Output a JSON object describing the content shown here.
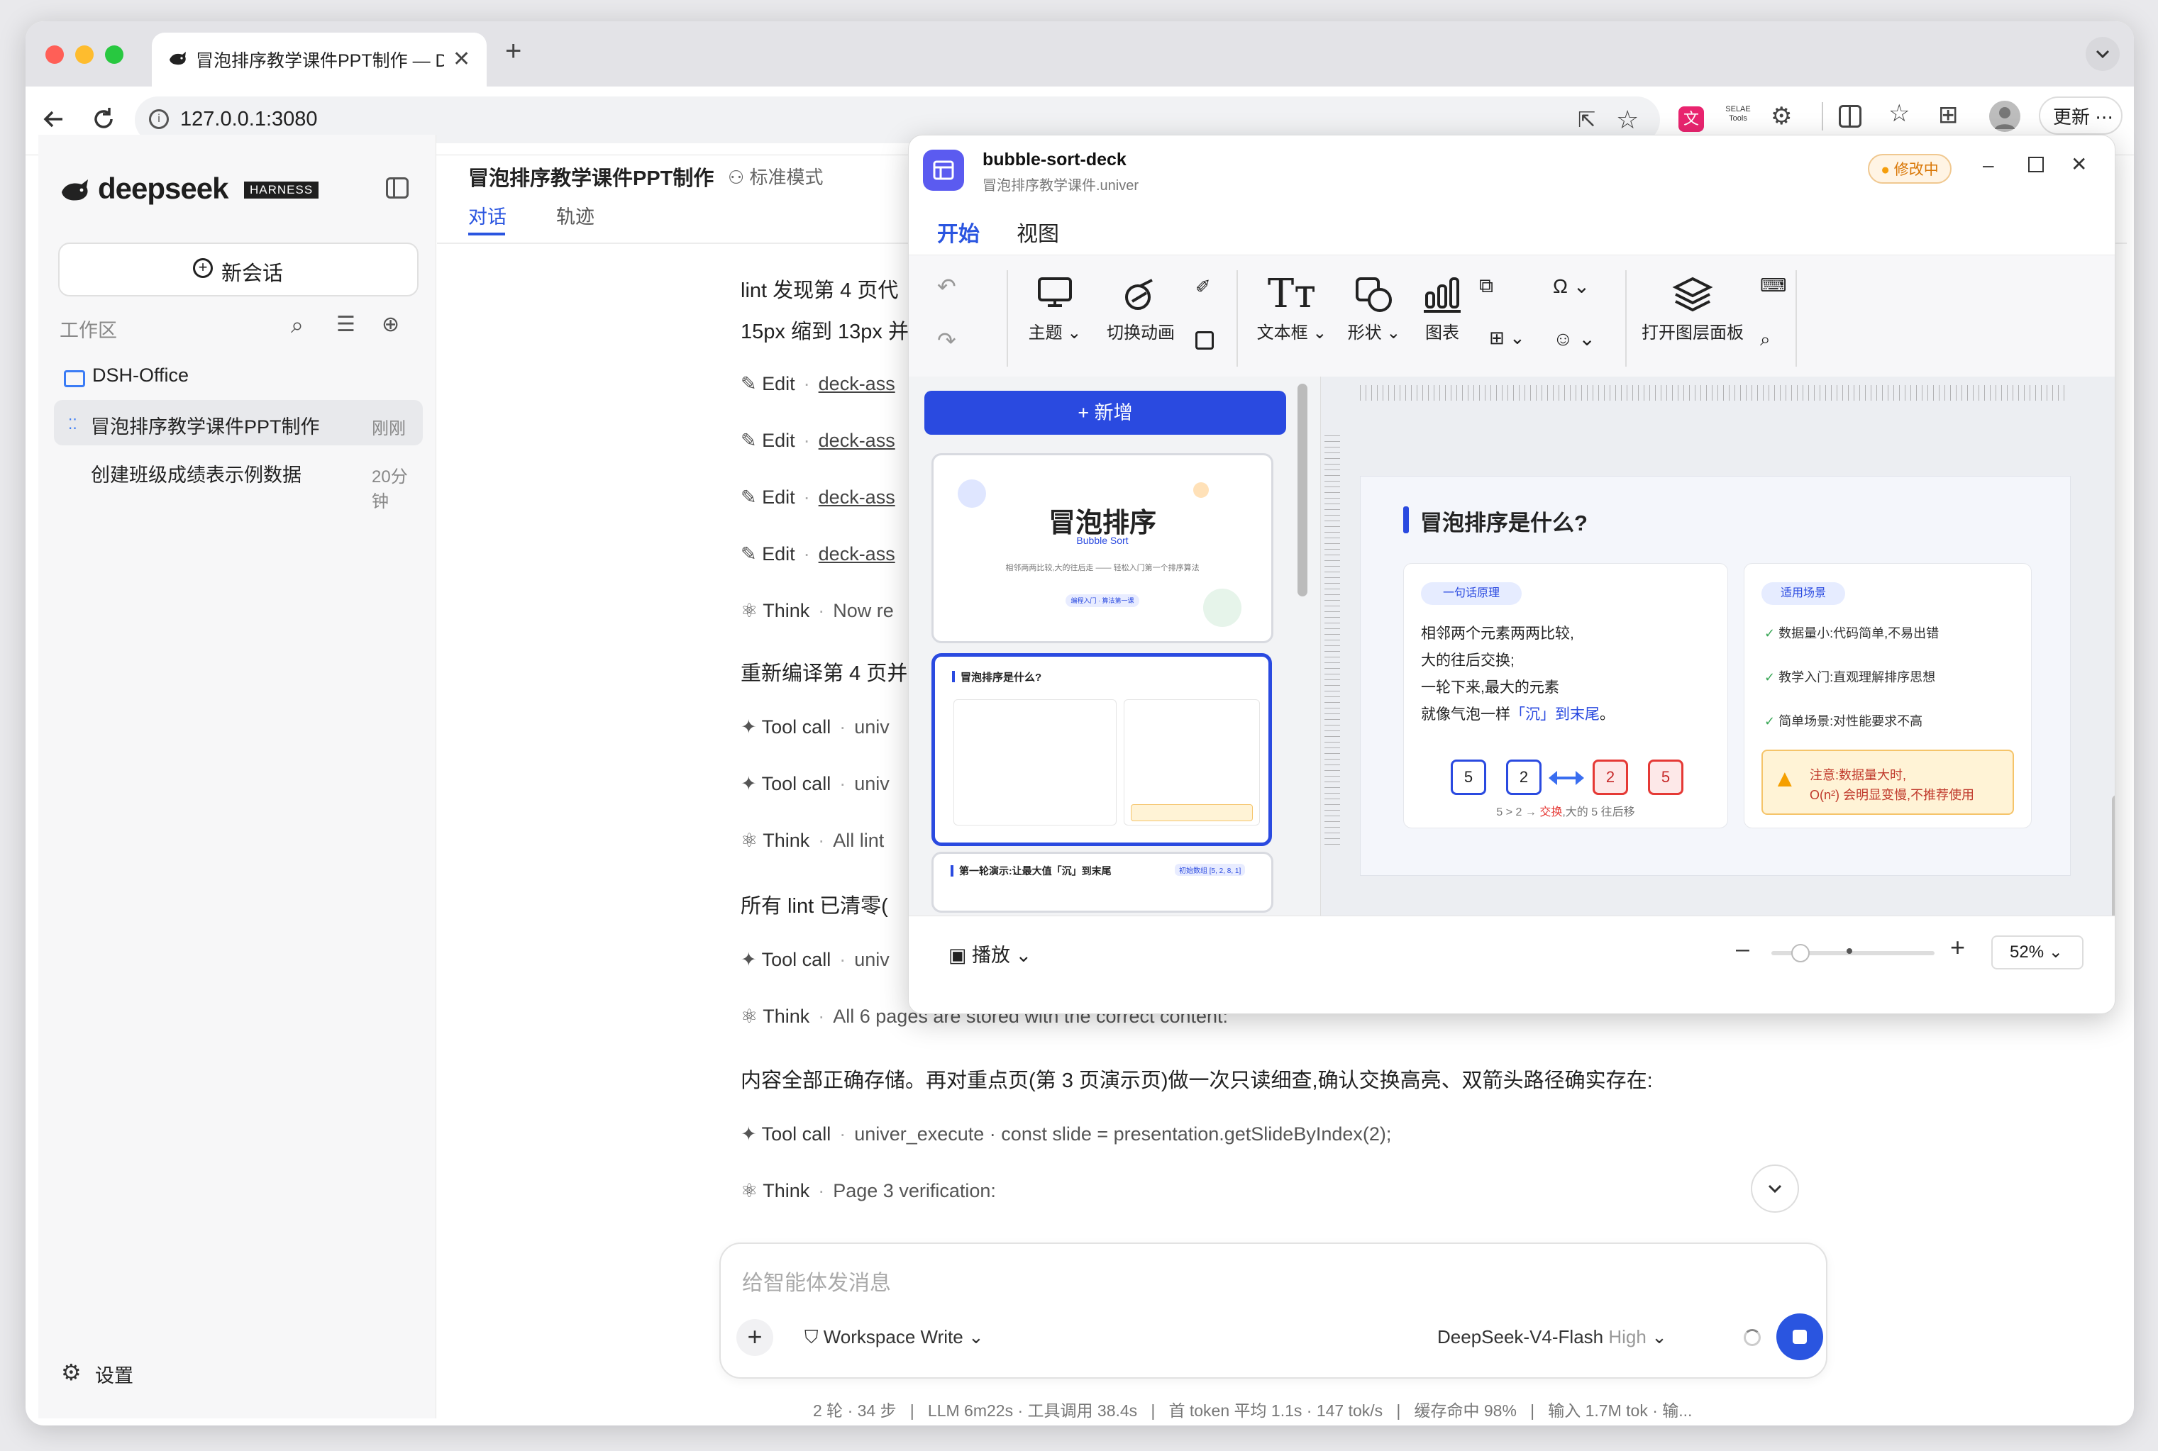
{
  "browser": {
    "tab_title": "冒泡排序教学课件PPT制作 — DeepSeek",
    "url": "127.0.0.1:3080",
    "update_label": "更新",
    "ext_label": "SELAE Tools"
  },
  "sidebar": {
    "brand": "deepseek",
    "brand_badge": "HARNESS",
    "new_chat": "新会话",
    "workspace_label": "工作区",
    "folder": "DSH-Office",
    "sessions": [
      {
        "title": "冒泡排序教学课件PPT制作",
        "time": "刚刚"
      },
      {
        "title": "创建班级成绩表示例数据",
        "time": "20分钟"
      }
    ],
    "settings": "设置"
  },
  "chat": {
    "title": "冒泡排序教学课件PPT制作",
    "mode": "标准模式",
    "tabs": [
      "对话",
      "轨迹"
    ],
    "lines": {
      "l1": "lint 发现第 4 页代",
      "l2": "15px 缩到 13px 并",
      "edit": "Edit",
      "edit_target": "deck-ass",
      "think": "Think",
      "think_now": "Now re",
      "recompile": "重新编译第 4 页并",
      "tool_call": "Tool call",
      "univ": "univ",
      "all_lint": "All lint",
      "cleared": "所有 lint 已清零(",
      "think_all6": "All 6 pages are stored with the correct content:",
      "verify_text": "内容全部正确存储。再对重点页(第 3 页演示页)做一次只读细查,确认交换高亮、双箭头路径确实存在:",
      "tool_call_full": "univer_execute · const slide = presentation.getSlideByIndex(2);",
      "think_page3": "Page 3 verification:"
    },
    "input_placeholder": "给智能体发消息",
    "workspace_write": "Workspace Write",
    "model": "DeepSeek-V4-Flash",
    "model_level": "High",
    "stats": "2 轮 · 34 步   |   LLM 6m22s · 工具调用 38.4s   |   首 token 平均 1.1s · 147 tok/s   |   缓存命中 98%   |   输入 1.7M tok · 输..."
  },
  "univer": {
    "title": "bubble-sort-deck",
    "subtitle": "冒泡排序教学课件.univer",
    "status": "修改中",
    "menu_tabs": [
      "开始",
      "视图"
    ],
    "toolbar": {
      "theme": "主题",
      "transition": "切换动画",
      "textbox": "文本框",
      "shape": "形状",
      "chart": "图表",
      "layers": "打开图层面板"
    },
    "add_slide": "+ 新增",
    "play": "播放",
    "zoom": "52%",
    "slide1": {
      "title": "冒泡排序",
      "subtitle": "Bubble Sort",
      "desc": "相邻两两比较,大的往后走 —— 轻松入门第一个排序算法",
      "tag": "编程入门 · 算法第一课"
    },
    "slide2": {
      "title": "冒泡排序是什么?",
      "left_tag": "一句话原理",
      "left_lines": [
        "相邻两个元素两两比较,",
        "大的往后交换;",
        "一轮下来,最大的元素",
        "就像气泡一样"
      ],
      "left_highlight": "「沉」到末尾",
      "left_end": "。",
      "boxes": [
        "5",
        "2",
        "2",
        "5"
      ],
      "caption_a": "5 > 2 → ",
      "caption_b": "交换",
      "caption_c": ",大的 5 往后移",
      "right_tag": "适用场景",
      "right_items": [
        "数据量小:代码简单,不易出错",
        "教学入门:直观理解排序思想",
        "简单场景:对性能要求不高"
      ],
      "warn_line1": "注意:数据量大时,",
      "warn_line2": "O(n²) 会明显变慢,不推荐使用"
    },
    "slide3": {
      "title": "第一轮演示:让最大值「沉」到末尾",
      "tag": "初始数组 [5, 2, 8, 1]"
    },
    "colors": {
      "accent": "#2a4ae0",
      "red": "#e53935",
      "orange": "#f59f00",
      "green": "#3aa757"
    }
  }
}
